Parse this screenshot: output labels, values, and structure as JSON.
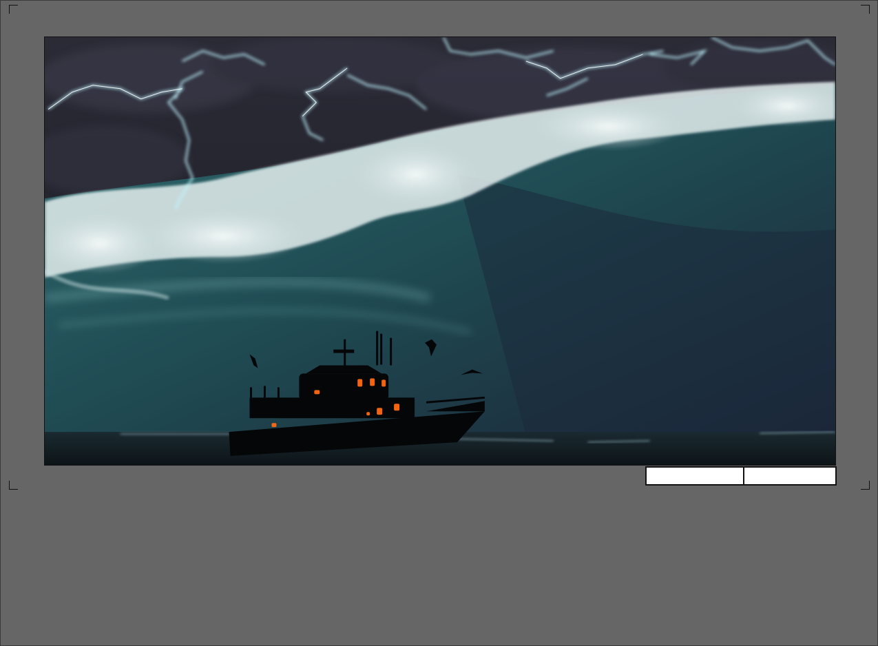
{
  "panel": {
    "caption_left": "",
    "caption_right": ""
  },
  "artwork": {
    "icon": "storm-wave-with-boat-illustration"
  },
  "colors": {
    "background": "#666666",
    "sky": "#25252f",
    "wave": "#1f4a52",
    "foam": "#e4eeee",
    "lightning": "#bff5ff",
    "window_glow": "#ff6a10"
  }
}
